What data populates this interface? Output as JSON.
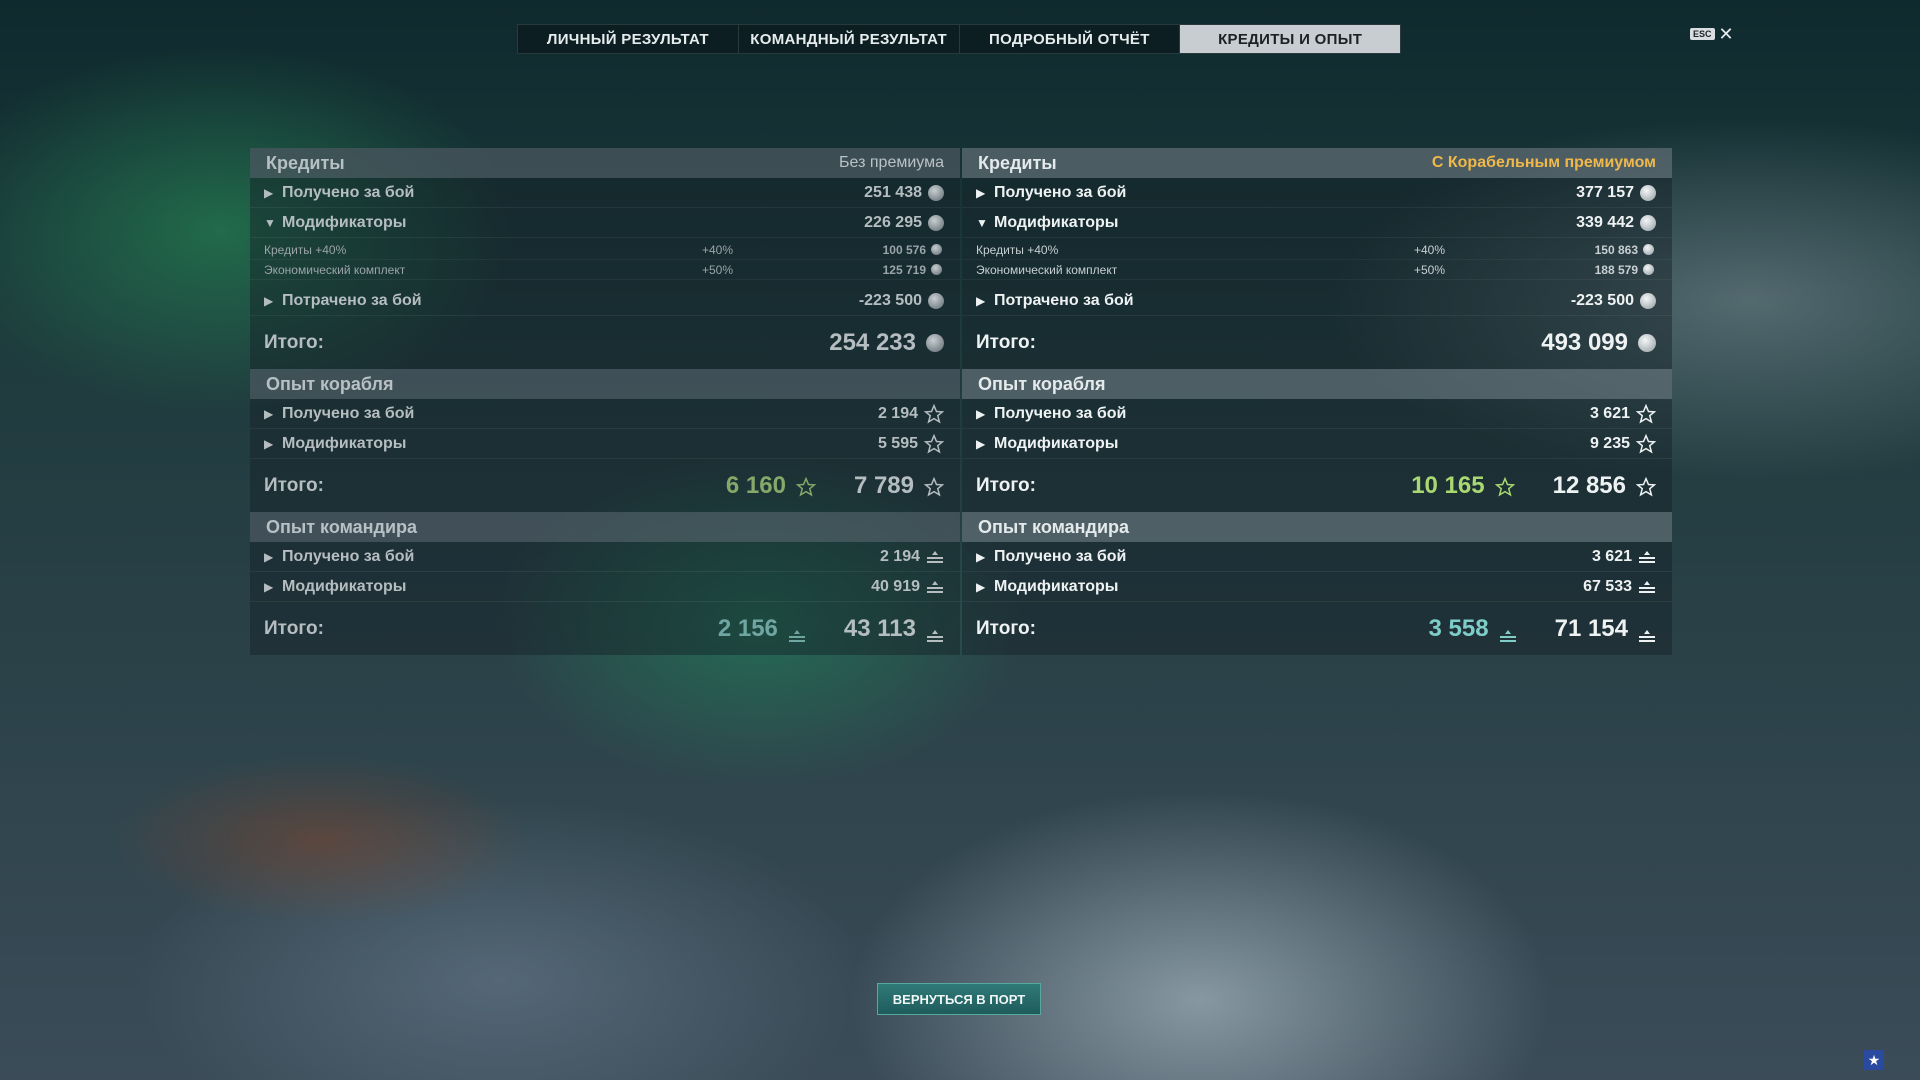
{
  "tabs": [
    {
      "label": "ЛИЧНЫЙ РЕЗУЛЬТАТ",
      "active": false
    },
    {
      "label": "КОМАНДНЫЙ РЕЗУЛЬТАТ",
      "active": false
    },
    {
      "label": "ПОДРОБНЫЙ ОТЧЁТ",
      "active": false
    },
    {
      "label": "КРЕДИТЫ И ОПЫТ",
      "active": true
    }
  ],
  "esc_label": "ESC",
  "close_symbol": "✕",
  "left": {
    "credits": {
      "title": "Кредиты",
      "subtitle": "Без премиума",
      "received_label": "Получено за бой",
      "received_value": "251 438",
      "modifiers_label": "Модификаторы",
      "modifiers_value": "226 295",
      "mod_rows": [
        {
          "label": "Кредиты +40%",
          "pct": "+40%",
          "value": "100 576"
        },
        {
          "label": "Экономический комплект",
          "pct": "+50%",
          "value": "125 719"
        }
      ],
      "spent_label": "Потрачено за бой",
      "spent_value": "-223 500",
      "total_label": "Итого:",
      "total_value": "254 233"
    },
    "ship_xp": {
      "title": "Опыт корабля",
      "received_label": "Получено за бой",
      "received_value": "2 194",
      "modifiers_label": "Модификаторы",
      "modifiers_value": "5 595",
      "total_label": "Итого:",
      "total_free": "6 160",
      "total_value": "7 789"
    },
    "commander_xp": {
      "title": "Опыт командира",
      "received_label": "Получено за бой",
      "received_value": "2 194",
      "modifiers_label": "Модификаторы",
      "modifiers_value": "40 919",
      "total_label": "Итого:",
      "total_free": "2 156",
      "total_value": "43 113"
    }
  },
  "right": {
    "credits": {
      "title": "Кредиты",
      "subtitle": "С Корабельным премиумом",
      "received_label": "Получено за бой",
      "received_value": "377 157",
      "modifiers_label": "Модификаторы",
      "modifiers_value": "339 442",
      "mod_rows": [
        {
          "label": "Кредиты +40%",
          "pct": "+40%",
          "value": "150 863"
        },
        {
          "label": "Экономический комплект",
          "pct": "+50%",
          "value": "188 579"
        }
      ],
      "spent_label": "Потрачено за бой",
      "spent_value": "-223 500",
      "total_label": "Итого:",
      "total_value": "493 099"
    },
    "ship_xp": {
      "title": "Опыт корабля",
      "received_label": "Получено за бой",
      "received_value": "3 621",
      "modifiers_label": "Модификаторы",
      "modifiers_value": "9 235",
      "total_label": "Итого:",
      "total_free": "10 165",
      "total_value": "12 856"
    },
    "commander_xp": {
      "title": "Опыт командира",
      "received_label": "Получено за бой",
      "received_value": "3 621",
      "modifiers_label": "Модификаторы",
      "modifiers_value": "67 533",
      "total_label": "Итого:",
      "total_free": "3 558",
      "total_value": "71 154"
    }
  },
  "return_button": "ВЕРНУТЬСЯ В ПОРТ",
  "colors": {
    "accent_gold": "#f0b84a",
    "free_xp_green": "#a9d870",
    "commander_teal": "#7fcdc8",
    "button_teal": "#2f7a78"
  }
}
